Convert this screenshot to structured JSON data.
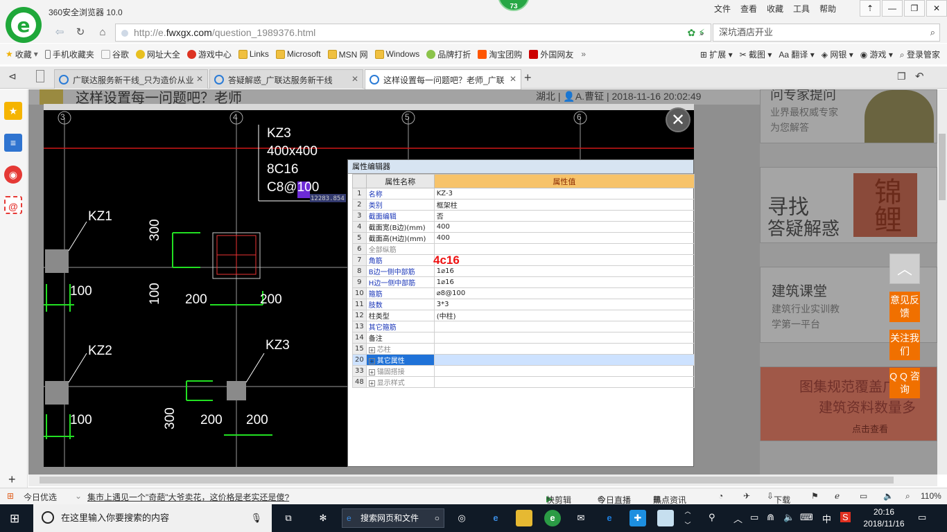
{
  "browser": {
    "title": "360安全浏览器 10.0",
    "badge_count": "73",
    "menu": [
      "文件",
      "查看",
      "收藏",
      "工具",
      "帮助"
    ],
    "url_prefix": "http://e.",
    "url_host": "fwxgx.com",
    "url_path": "/question_1989376.html",
    "search_placeholder": "深坑酒店开业"
  },
  "bookmarks": {
    "left": [
      {
        "label": "收藏"
      },
      {
        "label": "手机收藏夹"
      },
      {
        "label": "谷歌"
      },
      {
        "label": "网址大全"
      },
      {
        "label": "游戏中心"
      },
      {
        "label": "Links"
      },
      {
        "label": "Microsoft"
      },
      {
        "label": "MSN 网"
      },
      {
        "label": "Windows"
      },
      {
        "label": "品牌打折"
      },
      {
        "label": "淘宝团购"
      },
      {
        "label": "外国网友"
      }
    ],
    "right": [
      "扩展",
      "截图",
      "翻译",
      "网银",
      "游戏",
      "登录管家"
    ]
  },
  "tabs": [
    {
      "label": "广联达服务新干线_只为造价从业"
    },
    {
      "label": "答疑解惑_广联达服务新干线"
    },
    {
      "label": "这样设置每一问题吧？老师_广联"
    }
  ],
  "page": {
    "question_title": "这样设置每一问题吧？老师",
    "meta": "湖北 | 👤A.曹钲 | 2018-11-16 20:02:49",
    "expert_title": "问专家提问",
    "expert_sub1": "业界最权威专家",
    "expert_sub2": "为您解答",
    "card2_title": "寻找",
    "card2_sub": "答疑解惑",
    "card2_seal": "锦鲤",
    "card3_title": "建筑课堂",
    "card3_sub1": "建筑行业实训教",
    "card3_sub2": "学第一平台",
    "card4_title": "图集规范覆盖广",
    "card4_sub": "建筑资料数量多",
    "card4_link": "点击查看"
  },
  "float_buttons": {
    "feedback": "意见反馈",
    "follow": "关注我们",
    "qq": "Q Q 咨询"
  },
  "cad": {
    "kz3_label": "KZ3",
    "kz3_size": "400x400",
    "kz3_corner": "8C16",
    "kz3_stirrup": "C8@100",
    "coord": "12283.854",
    "grid_labels": [
      "3",
      "4",
      "5",
      "6"
    ],
    "kz1": "KZ1",
    "kz2": "KZ2",
    "kz3b": "KZ3",
    "dim_100": "100",
    "dim_200": "200",
    "dim_300": "300"
  },
  "prop_editor": {
    "title": "属性编辑器",
    "col_name": "属性名称",
    "col_value": "属性值",
    "rows": [
      {
        "n": "1",
        "k": "名称",
        "v": "KZ-3",
        "style": "blue"
      },
      {
        "n": "2",
        "k": "类别",
        "v": "框架柱",
        "style": "blue"
      },
      {
        "n": "3",
        "k": "截面编辑",
        "v": "否",
        "style": "blue"
      },
      {
        "n": "4",
        "k": "截面宽(B边)(mm)",
        "v": "400",
        "style": "black"
      },
      {
        "n": "5",
        "k": "截面高(H边)(mm)",
        "v": "400",
        "style": "black"
      },
      {
        "n": "6",
        "k": "全部纵筋",
        "v": "",
        "style": "gray"
      },
      {
        "n": "7",
        "k": "角筋",
        "v": "",
        "style": "blue"
      },
      {
        "n": "8",
        "k": "B边一侧中部筋",
        "v": "1⌀16",
        "style": "blue"
      },
      {
        "n": "9",
        "k": "H边一侧中部筋",
        "v": "1⌀16",
        "style": "blue"
      },
      {
        "n": "10",
        "k": "箍筋",
        "v": "⌀8@100",
        "style": "blue"
      },
      {
        "n": "11",
        "k": "肢数",
        "v": "3*3",
        "style": "blue"
      },
      {
        "n": "12",
        "k": "柱类型",
        "v": "(中柱)",
        "style": "black"
      },
      {
        "n": "13",
        "k": "其它箍筋",
        "v": "",
        "style": "blue"
      },
      {
        "n": "14",
        "k": "备注",
        "v": "",
        "style": "black"
      },
      {
        "n": "15",
        "k": "芯柱",
        "v": "",
        "style": "gray",
        "expand": true
      },
      {
        "n": "20",
        "k": "其它属性",
        "v": "",
        "style": "sel",
        "expand": true
      },
      {
        "n": "33",
        "k": "锚固搭接",
        "v": "",
        "style": "gray",
        "expand": true
      },
      {
        "n": "48",
        "k": "显示样式",
        "v": "",
        "style": "gray",
        "expand": true
      }
    ],
    "red_note": "4c16"
  },
  "status": {
    "news_label": "今日优选",
    "news_text": "集市上遇见一个\"奇葩\"大爷卖花，这价格是老实还是傻?",
    "items": [
      "快剪辑",
      "今日直播",
      "热点资讯",
      "下载"
    ],
    "zoom": "110%"
  },
  "taskbar": {
    "search_placeholder": "在这里输入你要搜索的内容",
    "web_search": "搜索网页和文件",
    "ime": "中",
    "time": "20:16",
    "date": "2018/11/16"
  }
}
